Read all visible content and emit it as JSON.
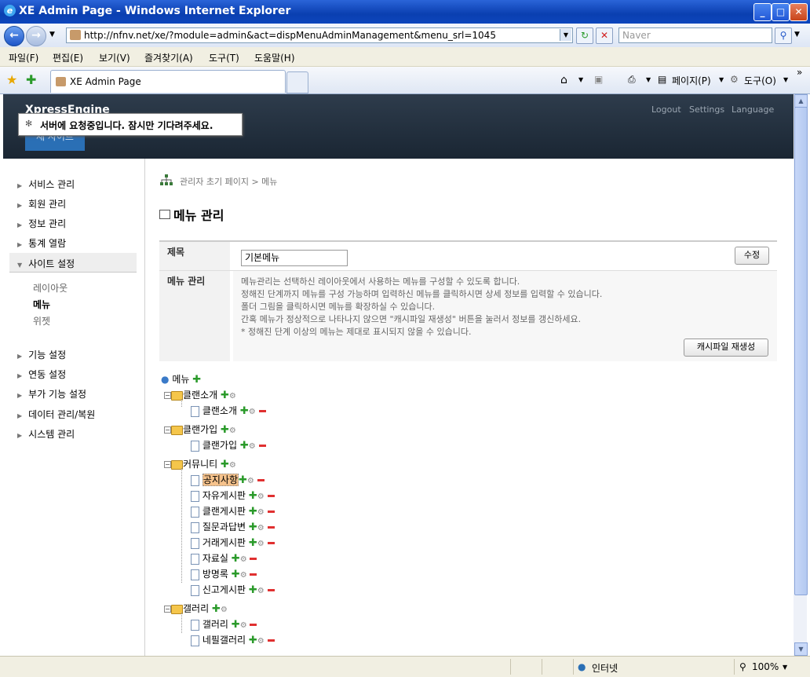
{
  "window": {
    "title": "XE Admin Page - Windows Internet Explorer",
    "min": "_",
    "max": "□",
    "close": "✕"
  },
  "address": {
    "url": "http://nfnv.net/xe/?module=admin&act=dispMenuAdminManagement&menu_srl=1045",
    "search_placeholder": "Naver"
  },
  "menubar": [
    "파일(F)",
    "편집(E)",
    "보기(V)",
    "즐겨찾기(A)",
    "도구(T)",
    "도움말(H)"
  ],
  "tab": {
    "title": "XE Admin Page"
  },
  "toolbar_right": {
    "page": "페이지(P)",
    "tools": "도구(O)"
  },
  "header": {
    "brand": "XpressEngine",
    "button": "새 사이트",
    "links": [
      "Logout",
      "Settings",
      "Language"
    ]
  },
  "loading": "서버에 요청중입니다. 잠시만 기다려주세요.",
  "sidebar": {
    "groups_top": [
      "서비스 관리",
      "회원 관리",
      "정보 관리",
      "통계 열람",
      "사이트 설정"
    ],
    "sub": [
      "레이아웃",
      "메뉴",
      "위젯"
    ],
    "groups_bottom": [
      "기능 설정",
      "연동 설정",
      "부가 기능 설정",
      "데이터 관리/복원",
      "시스템 관리"
    ]
  },
  "breadcrumb": "관리자 초기 페이지 > 메뉴",
  "page_title": "메뉴 관리",
  "form": {
    "title_label": "제목",
    "title_value": "기본메뉴",
    "modify_button": "수정",
    "manage_label": "메뉴 관리",
    "desc": [
      "메뉴관리는 선택하신 레이아웃에서 사용하는 메뉴를 구성할 수 있도록 합니다.",
      "정해진 단계까지 메뉴를 구성 가능하며 입력하신 메뉴를 클릭하시면 상세 정보를 입력할 수 있습니다.",
      "폴더 그림을 클릭하시면 메뉴를 확장하실 수 있습니다.",
      "간혹 메뉴가 정상적으로 나타나지 않으면 \"캐시파일 재생성\" 버튼을 눌러서 정보를 갱신하세요.",
      "* 정해진 단계 이상의 메뉴는 제대로 표시되지 않을 수 있습니다."
    ],
    "cache_button": "캐시파일 재생성"
  },
  "tree": {
    "root": "메뉴",
    "folders": [
      {
        "name": "클랜소개",
        "items": [
          "클랜소개"
        ]
      },
      {
        "name": "클랜가입",
        "items": [
          "클랜가입"
        ]
      },
      {
        "name": "커뮤니티",
        "items": [
          "공지사항",
          "자유게시판",
          "클랜게시판",
          "질문과답변",
          "거래게시판",
          "자료실",
          "방명록",
          "신고게시판"
        ]
      },
      {
        "name": "갤러리",
        "items": [
          "갤러리",
          "네필갤러리"
        ]
      }
    ]
  },
  "status": {
    "zone": "인터넷",
    "zoom": "100%"
  }
}
